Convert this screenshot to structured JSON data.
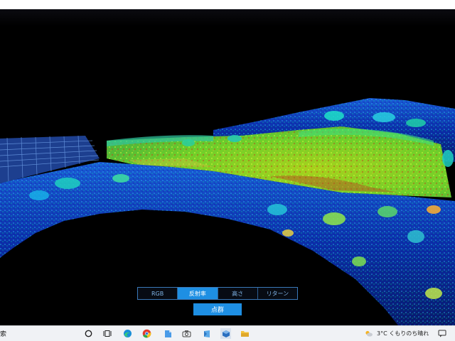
{
  "viewer": {
    "view_modes": [
      {
        "label": "RGB",
        "active": false
      },
      {
        "label": "反射率",
        "active": true
      },
      {
        "label": "高さ",
        "active": false
      },
      {
        "label": "リターン",
        "active": false
      }
    ],
    "point_cloud_button": "点群",
    "accent_color": "#1e8fe3"
  },
  "taskbar": {
    "search_fragment": "索",
    "pinned_icons": [
      "task-view-icon",
      "edge-icon",
      "chrome-icon",
      "file-icon",
      "camera-icon",
      "app-icon",
      "cube-app-icon",
      "file-explorer-icon"
    ],
    "weather_text": "3°C くもりのち晴れ",
    "tray_icons": [
      "weather-icon",
      "chat-icon"
    ]
  }
}
